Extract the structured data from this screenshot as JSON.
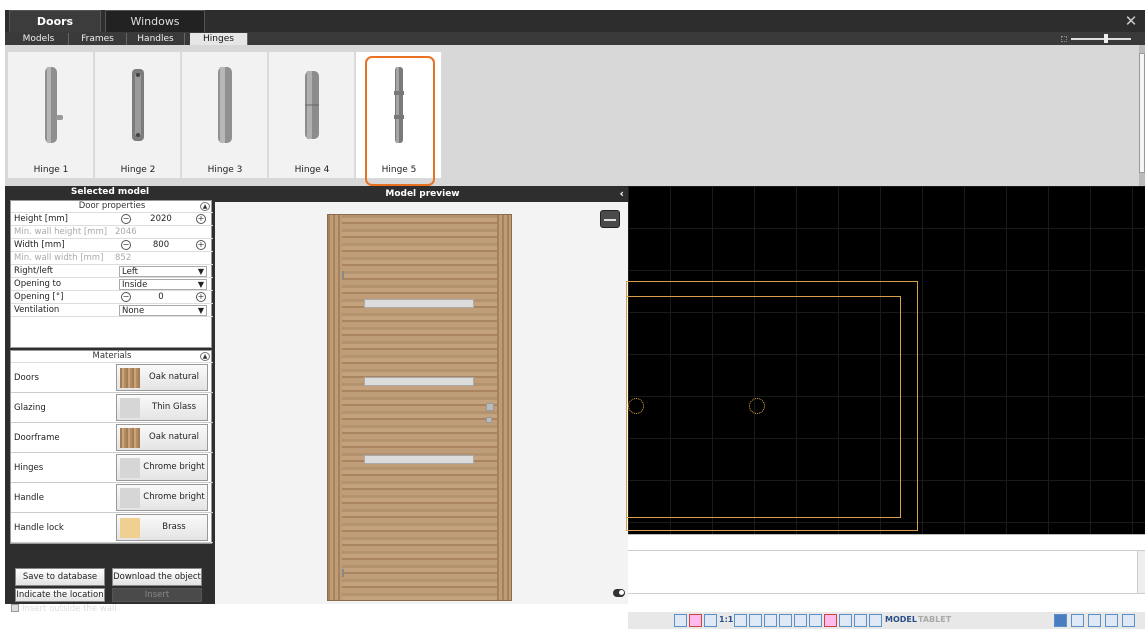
{
  "top_tabs": [
    "Doors",
    "Windows"
  ],
  "sub_tabs": [
    "Models",
    "Frames",
    "Handles",
    "Hinges"
  ],
  "selected_sub_tab": "Hinges",
  "hinges": [
    {
      "label": "Hinge 1",
      "selected": false
    },
    {
      "label": "Hinge 2",
      "selected": false
    },
    {
      "label": "Hinge 3",
      "selected": false
    },
    {
      "label": "Hinge 4",
      "selected": false
    },
    {
      "label": "Hinge 5",
      "selected": true
    }
  ],
  "left_panel": {
    "title": "Selected model",
    "door_properties": {
      "heading": "Door properties",
      "height_label": "Height [mm]",
      "height_value": "2020",
      "min_wall_height_label": "Min. wall height [mm]",
      "min_wall_height_value": "2046",
      "width_label": "Width [mm]",
      "width_value": "800",
      "min_wall_width_label": "Min. wall width [mm]",
      "min_wall_width_value": "852",
      "right_left_label": "Right/left",
      "right_left_value": "Left",
      "opening_to_label": "Opening to",
      "opening_to_value": "Inside",
      "opening_label": "Opening [°]",
      "opening_value": "0",
      "ventilation_label": "Ventilation",
      "ventilation_value": "None"
    },
    "materials": {
      "heading": "Materials",
      "rows": [
        {
          "label": "Doors",
          "value": "Oak natural"
        },
        {
          "label": "Glazing",
          "value": "Thin Glass"
        },
        {
          "label": "Doorframe",
          "value": "Oak natural"
        },
        {
          "label": "Hinges",
          "value": "Chrome bright"
        },
        {
          "label": "Handle",
          "value": "Chrome bright"
        },
        {
          "label": "Handle lock",
          "value": "Brass"
        }
      ]
    },
    "buttons": {
      "save": "Save to database",
      "download": "Download the object",
      "indicate": "Indicate the location",
      "insert": "Insert"
    },
    "insert_outside_label": "Insert outside the wall"
  },
  "preview": {
    "title": "Model preview",
    "collapse_glyph": "‹"
  },
  "status_bar": {
    "scale_label": "1:1",
    "model_label": "MODEL",
    "tablet_label": "TABLET"
  },
  "colors": {
    "accent_highlight": "#e97122",
    "cad_background": "#000000",
    "cad_lines": "#d9a04a"
  }
}
